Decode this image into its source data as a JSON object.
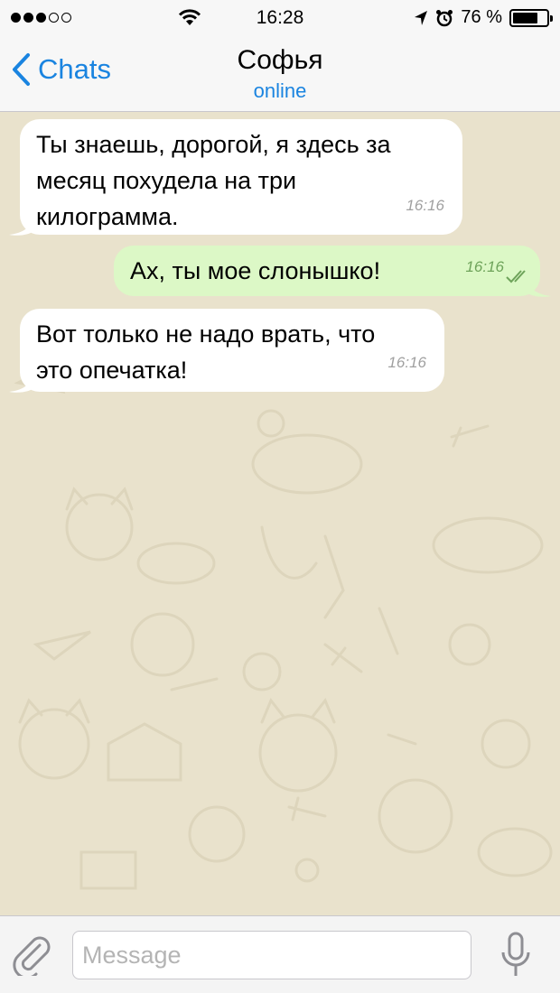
{
  "status_bar": {
    "time": "16:28",
    "battery_percent": "76 %",
    "battery_level": 0.76,
    "icons": [
      "signal-dots-icon",
      "wifi-icon",
      "location-arrow-icon",
      "alarm-icon",
      "battery-icon"
    ]
  },
  "nav": {
    "back_label": "Chats",
    "title": "Софья",
    "subtitle": "online"
  },
  "messages": [
    {
      "direction": "incoming",
      "lines": [
        "Ты знаешь, дорогой, я здесь за",
        "месяц похудела на три",
        "килограмма."
      ],
      "time": "16:16"
    },
    {
      "direction": "outgoing",
      "lines": [
        "Ах, ты мое слонышко!"
      ],
      "time": "16:16",
      "status_icon": "double-check-icon"
    },
    {
      "direction": "incoming",
      "lines": [
        "Вот только не надо врать, что",
        "это опечатка!"
      ],
      "time": "16:16"
    }
  ],
  "input": {
    "placeholder": "Message",
    "value": ""
  },
  "colors": {
    "accent": "#1a84e0",
    "wallpaper": "#e9e2cc",
    "incoming_bubble": "#ffffff",
    "outgoing_bubble": "#dcf8c6",
    "read_ticks": "#6ea35a"
  }
}
